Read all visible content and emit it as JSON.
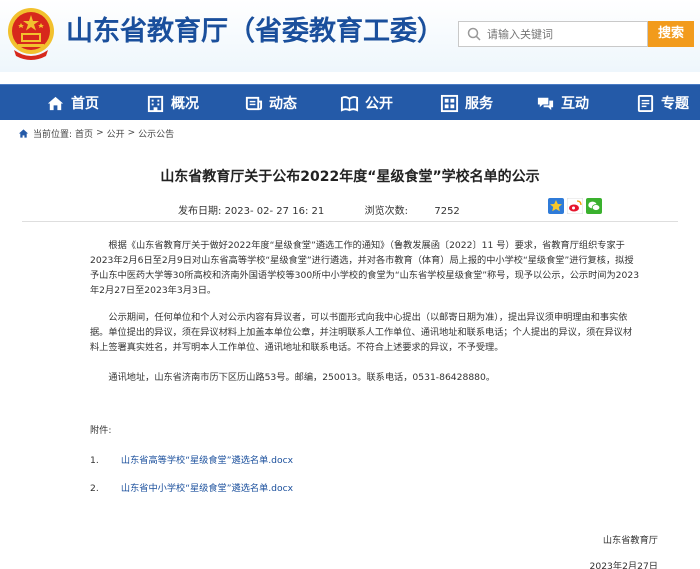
{
  "header": {
    "site_title": "山东省教育厅（省委教育工委）",
    "search_placeholder": "请输入关键词",
    "search_button": "搜索"
  },
  "nav": {
    "items": [
      {
        "label": "首页",
        "icon": "home-icon"
      },
      {
        "label": "概况",
        "icon": "building-icon"
      },
      {
        "label": "动态",
        "icon": "news-icon"
      },
      {
        "label": "公开",
        "icon": "book-icon"
      },
      {
        "label": "服务",
        "icon": "grid-icon"
      },
      {
        "label": "互动",
        "icon": "chat-icon"
      },
      {
        "label": "专题",
        "icon": "topic-icon"
      }
    ]
  },
  "breadcrumb": {
    "prefix": "当前位置:",
    "items": [
      "首页",
      "公开",
      "公示公告"
    ],
    "sep": ">"
  },
  "article": {
    "title": "山东省教育厅关于公布2022年度“星级食堂”学校名单的公示",
    "publish_label": "发布日期:",
    "publish_date": "2023- 02- 27 16: 21",
    "views_label": "浏览次数:",
    "views": "7252",
    "paragraphs": [
      "根据《山东省教育厅关于做好2022年度“星级食堂”遴选工作的通知》（鲁教发展函〔2022〕11 号）要求，省教育厅组织专家于2023年2月6日至2月9日对山东省高等学校“星级食堂”进行遴选，并对各市教育（体育）局上报的中小学校“星级食堂”进行复核，拟授予山东中医药大学等30所高校和济南外国语学校等300所中小学校的食堂为“山东省学校星级食堂”称号，现予以公示，公示时间为2023年2月27日至2023年3月3日。",
      "公示期间，任何单位和个人对公示内容有异议者，可以书面形式向我中心提出（以邮寄日期为准），提出异议须申明理由和事实依据。单位提出的异议，须在异议材料上加盖本单位公章，并注明联系人工作单位、通讯地址和联系电话；个人提出的异议，须在异议材料上签署真实姓名，并写明本人工作单位、通讯地址和联系电话。不符合上述要求的异议，不予受理。",
      "通讯地址，山东省济南市历下区历山路53号。邮编，250013。联系电话，0531-86428880。"
    ],
    "attachments_label": "附件:",
    "attachments": [
      {
        "num": "1.",
        "name": "山东省高等学校“星级食堂”遴选名单.docx"
      },
      {
        "num": "2.",
        "name": "山东省中小学校“星级食堂”遴选名单.docx"
      }
    ],
    "signature": "山东省教育厅",
    "sign_date": "2023年2月27日"
  },
  "colors": {
    "nav_bg": "#245aa8",
    "title_blue": "#1a4f9c",
    "search_orange": "#f29b1c",
    "emblem_red": "#d7281c",
    "emblem_gold": "#f2c12e"
  }
}
